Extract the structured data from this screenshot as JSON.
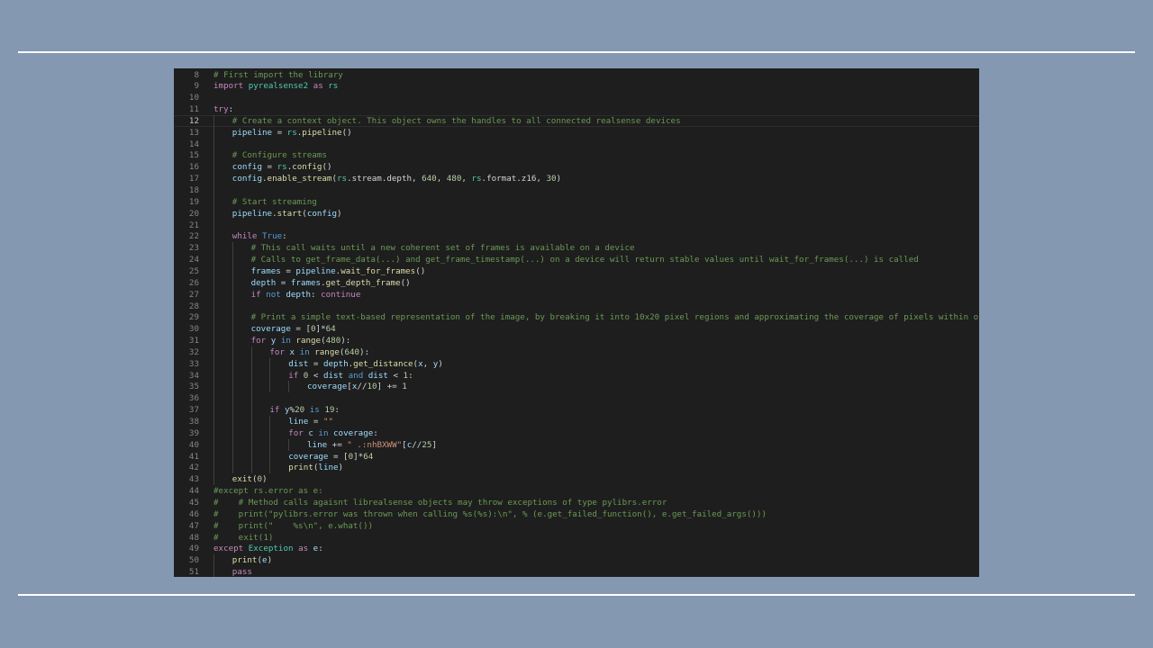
{
  "lines": [
    {
      "n": "8",
      "indent": 0,
      "tokens": [
        {
          "t": "# First import the library",
          "c": "cm"
        }
      ]
    },
    {
      "n": "9",
      "indent": 0,
      "tokens": [
        {
          "t": "import ",
          "c": "kw"
        },
        {
          "t": "pyrealsense2",
          "c": "ty"
        },
        {
          "t": " as ",
          "c": "kw"
        },
        {
          "t": "rs",
          "c": "ty"
        }
      ]
    },
    {
      "n": "10",
      "indent": 0,
      "tokens": []
    },
    {
      "n": "11",
      "indent": 0,
      "tokens": [
        {
          "t": "try",
          "c": "kw"
        },
        {
          "t": ":",
          "c": ""
        }
      ]
    },
    {
      "n": "12",
      "indent": 1,
      "active": true,
      "tokens": [
        {
          "t": "# Create a context object. This object owns the handles to all connected realsense devices",
          "c": "cm"
        }
      ]
    },
    {
      "n": "13",
      "indent": 1,
      "tokens": [
        {
          "t": "pipeline",
          "c": "vr"
        },
        {
          "t": " = ",
          "c": ""
        },
        {
          "t": "rs",
          "c": "ty"
        },
        {
          "t": ".",
          "c": ""
        },
        {
          "t": "pipeline",
          "c": "fn"
        },
        {
          "t": "()",
          "c": ""
        }
      ]
    },
    {
      "n": "14",
      "indent": 1,
      "tokens": []
    },
    {
      "n": "15",
      "indent": 1,
      "tokens": [
        {
          "t": "# Configure streams",
          "c": "cm"
        }
      ]
    },
    {
      "n": "16",
      "indent": 1,
      "tokens": [
        {
          "t": "config",
          "c": "vr"
        },
        {
          "t": " = ",
          "c": ""
        },
        {
          "t": "rs",
          "c": "ty"
        },
        {
          "t": ".",
          "c": ""
        },
        {
          "t": "config",
          "c": "fn"
        },
        {
          "t": "()",
          "c": ""
        }
      ]
    },
    {
      "n": "17",
      "indent": 1,
      "tokens": [
        {
          "t": "config",
          "c": "vr"
        },
        {
          "t": ".",
          "c": ""
        },
        {
          "t": "enable_stream",
          "c": "fn"
        },
        {
          "t": "(",
          "c": ""
        },
        {
          "t": "rs",
          "c": "ty"
        },
        {
          "t": ".stream.depth, ",
          "c": ""
        },
        {
          "t": "640",
          "c": "nm"
        },
        {
          "t": ", ",
          "c": ""
        },
        {
          "t": "480",
          "c": "nm"
        },
        {
          "t": ", ",
          "c": ""
        },
        {
          "t": "rs",
          "c": "ty"
        },
        {
          "t": ".format.z16, ",
          "c": ""
        },
        {
          "t": "30",
          "c": "nm"
        },
        {
          "t": ")",
          "c": ""
        }
      ]
    },
    {
      "n": "18",
      "indent": 1,
      "tokens": []
    },
    {
      "n": "19",
      "indent": 1,
      "tokens": [
        {
          "t": "# Start streaming",
          "c": "cm"
        }
      ]
    },
    {
      "n": "20",
      "indent": 1,
      "tokens": [
        {
          "t": "pipeline",
          "c": "vr"
        },
        {
          "t": ".",
          "c": ""
        },
        {
          "t": "start",
          "c": "fn"
        },
        {
          "t": "(",
          "c": ""
        },
        {
          "t": "config",
          "c": "vr"
        },
        {
          "t": ")",
          "c": ""
        }
      ]
    },
    {
      "n": "21",
      "indent": 1,
      "tokens": []
    },
    {
      "n": "22",
      "indent": 1,
      "tokens": [
        {
          "t": "while ",
          "c": "kw"
        },
        {
          "t": "True",
          "c": "kb"
        },
        {
          "t": ":",
          "c": ""
        }
      ]
    },
    {
      "n": "23",
      "indent": 2,
      "tokens": [
        {
          "t": "# This call waits until a new coherent set of frames is available on a device",
          "c": "cm"
        }
      ]
    },
    {
      "n": "24",
      "indent": 2,
      "tokens": [
        {
          "t": "# Calls to get_frame_data(...) and get_frame_timestamp(...) on a device will return stable values until wait_for_frames(...) is called",
          "c": "cm"
        }
      ]
    },
    {
      "n": "25",
      "indent": 2,
      "tokens": [
        {
          "t": "frames",
          "c": "vr"
        },
        {
          "t": " = ",
          "c": ""
        },
        {
          "t": "pipeline",
          "c": "vr"
        },
        {
          "t": ".",
          "c": ""
        },
        {
          "t": "wait_for_frames",
          "c": "fn"
        },
        {
          "t": "()",
          "c": ""
        }
      ]
    },
    {
      "n": "26",
      "indent": 2,
      "tokens": [
        {
          "t": "depth",
          "c": "vr"
        },
        {
          "t": " = ",
          "c": ""
        },
        {
          "t": "frames",
          "c": "vr"
        },
        {
          "t": ".",
          "c": ""
        },
        {
          "t": "get_depth_frame",
          "c": "fn"
        },
        {
          "t": "()",
          "c": ""
        }
      ]
    },
    {
      "n": "27",
      "indent": 2,
      "tokens": [
        {
          "t": "if ",
          "c": "kw"
        },
        {
          "t": "not ",
          "c": "kb"
        },
        {
          "t": "depth",
          "c": "vr"
        },
        {
          "t": ": ",
          "c": ""
        },
        {
          "t": "continue",
          "c": "kw"
        }
      ]
    },
    {
      "n": "28",
      "indent": 2,
      "tokens": []
    },
    {
      "n": "29",
      "indent": 2,
      "tokens": [
        {
          "t": "# Print a simple text-based representation of the image, by breaking it into 10x20 pixel regions and approximating the coverage of pixels within one meter",
          "c": "cm"
        }
      ]
    },
    {
      "n": "30",
      "indent": 2,
      "tokens": [
        {
          "t": "coverage",
          "c": "vr"
        },
        {
          "t": " = [",
          "c": ""
        },
        {
          "t": "0",
          "c": "nm"
        },
        {
          "t": "]*",
          "c": ""
        },
        {
          "t": "64",
          "c": "nm"
        }
      ]
    },
    {
      "n": "31",
      "indent": 2,
      "tokens": [
        {
          "t": "for ",
          "c": "kw"
        },
        {
          "t": "y",
          "c": "vr"
        },
        {
          "t": " in ",
          "c": "kb"
        },
        {
          "t": "range",
          "c": "fn"
        },
        {
          "t": "(",
          "c": ""
        },
        {
          "t": "480",
          "c": "nm"
        },
        {
          "t": "):",
          "c": ""
        }
      ]
    },
    {
      "n": "32",
      "indent": 3,
      "tokens": [
        {
          "t": "for ",
          "c": "kw"
        },
        {
          "t": "x",
          "c": "vr"
        },
        {
          "t": " in ",
          "c": "kb"
        },
        {
          "t": "range",
          "c": "fn"
        },
        {
          "t": "(",
          "c": ""
        },
        {
          "t": "640",
          "c": "nm"
        },
        {
          "t": "):",
          "c": ""
        }
      ]
    },
    {
      "n": "33",
      "indent": 4,
      "tokens": [
        {
          "t": "dist",
          "c": "vr"
        },
        {
          "t": " = ",
          "c": ""
        },
        {
          "t": "depth",
          "c": "vr"
        },
        {
          "t": ".",
          "c": ""
        },
        {
          "t": "get_distance",
          "c": "fn"
        },
        {
          "t": "(",
          "c": ""
        },
        {
          "t": "x",
          "c": "vr"
        },
        {
          "t": ", ",
          "c": ""
        },
        {
          "t": "y",
          "c": "vr"
        },
        {
          "t": ")",
          "c": ""
        }
      ]
    },
    {
      "n": "34",
      "indent": 4,
      "tokens": [
        {
          "t": "if ",
          "c": "kw"
        },
        {
          "t": "0",
          "c": "nm"
        },
        {
          "t": " < ",
          "c": ""
        },
        {
          "t": "dist",
          "c": "vr"
        },
        {
          "t": " and ",
          "c": "kb"
        },
        {
          "t": "dist",
          "c": "vr"
        },
        {
          "t": " < ",
          "c": ""
        },
        {
          "t": "1",
          "c": "nm"
        },
        {
          "t": ":",
          "c": ""
        }
      ]
    },
    {
      "n": "35",
      "indent": 5,
      "tokens": [
        {
          "t": "coverage",
          "c": "vr"
        },
        {
          "t": "[",
          "c": ""
        },
        {
          "t": "x",
          "c": "vr"
        },
        {
          "t": "//",
          "c": ""
        },
        {
          "t": "10",
          "c": "nm"
        },
        {
          "t": "] += ",
          "c": ""
        },
        {
          "t": "1",
          "c": "nm"
        }
      ]
    },
    {
      "n": "36",
      "indent": 3,
      "tokens": []
    },
    {
      "n": "37",
      "indent": 3,
      "tokens": [
        {
          "t": "if ",
          "c": "kw"
        },
        {
          "t": "y",
          "c": "vr"
        },
        {
          "t": "%",
          "c": ""
        },
        {
          "t": "20",
          "c": "nm"
        },
        {
          "t": " is ",
          "c": "kb"
        },
        {
          "t": "19",
          "c": "nm"
        },
        {
          "t": ":",
          "c": ""
        }
      ]
    },
    {
      "n": "38",
      "indent": 4,
      "tokens": [
        {
          "t": "line",
          "c": "vr"
        },
        {
          "t": " = ",
          "c": ""
        },
        {
          "t": "\"\"",
          "c": "st"
        }
      ]
    },
    {
      "n": "39",
      "indent": 4,
      "tokens": [
        {
          "t": "for ",
          "c": "kw"
        },
        {
          "t": "c",
          "c": "vr"
        },
        {
          "t": " in ",
          "c": "kb"
        },
        {
          "t": "coverage",
          "c": "vr"
        },
        {
          "t": ":",
          "c": ""
        }
      ]
    },
    {
      "n": "40",
      "indent": 5,
      "tokens": [
        {
          "t": "line",
          "c": "vr"
        },
        {
          "t": " += ",
          "c": ""
        },
        {
          "t": "\" .:nhBXWW\"",
          "c": "st"
        },
        {
          "t": "[",
          "c": ""
        },
        {
          "t": "c",
          "c": "vr"
        },
        {
          "t": "//",
          "c": ""
        },
        {
          "t": "25",
          "c": "nm"
        },
        {
          "t": "]",
          "c": ""
        }
      ]
    },
    {
      "n": "41",
      "indent": 4,
      "tokens": [
        {
          "t": "coverage",
          "c": "vr"
        },
        {
          "t": " = [",
          "c": ""
        },
        {
          "t": "0",
          "c": "nm"
        },
        {
          "t": "]*",
          "c": ""
        },
        {
          "t": "64",
          "c": "nm"
        }
      ]
    },
    {
      "n": "42",
      "indent": 4,
      "tokens": [
        {
          "t": "print",
          "c": "fn"
        },
        {
          "t": "(",
          "c": ""
        },
        {
          "t": "line",
          "c": "vr"
        },
        {
          "t": ")",
          "c": ""
        }
      ]
    },
    {
      "n": "43",
      "indent": 1,
      "tokens": [
        {
          "t": "exit",
          "c": "fn"
        },
        {
          "t": "(",
          "c": ""
        },
        {
          "t": "0",
          "c": "nm"
        },
        {
          "t": ")",
          "c": ""
        }
      ]
    },
    {
      "n": "44",
      "indent": 0,
      "tokens": [
        {
          "t": "#except rs.error as e:",
          "c": "cm"
        }
      ]
    },
    {
      "n": "45",
      "indent": 0,
      "tokens": [
        {
          "t": "#    # Method calls agaisnt librealsense objects may throw exceptions of type pylibrs.error",
          "c": "cm"
        }
      ]
    },
    {
      "n": "46",
      "indent": 0,
      "tokens": [
        {
          "t": "#    print(\"pylibrs.error was thrown when calling %s(%s):\\n\", % (e.get_failed_function(), e.get_failed_args()))",
          "c": "cm"
        }
      ]
    },
    {
      "n": "47",
      "indent": 0,
      "tokens": [
        {
          "t": "#    print(\"    %s\\n\", e.what())",
          "c": "cm"
        }
      ]
    },
    {
      "n": "48",
      "indent": 0,
      "tokens": [
        {
          "t": "#    exit(1)",
          "c": "cm"
        }
      ]
    },
    {
      "n": "49",
      "indent": 0,
      "tokens": [
        {
          "t": "except ",
          "c": "kw"
        },
        {
          "t": "Exception",
          "c": "ty"
        },
        {
          "t": " as ",
          "c": "kw"
        },
        {
          "t": "e",
          "c": "vr"
        },
        {
          "t": ":",
          "c": ""
        }
      ]
    },
    {
      "n": "50",
      "indent": 1,
      "tokens": [
        {
          "t": "print",
          "c": "fn"
        },
        {
          "t": "(",
          "c": ""
        },
        {
          "t": "e",
          "c": "vr"
        },
        {
          "t": ")",
          "c": ""
        }
      ]
    },
    {
      "n": "51",
      "indent": 1,
      "tokens": [
        {
          "t": "pass",
          "c": "kw"
        }
      ]
    }
  ]
}
